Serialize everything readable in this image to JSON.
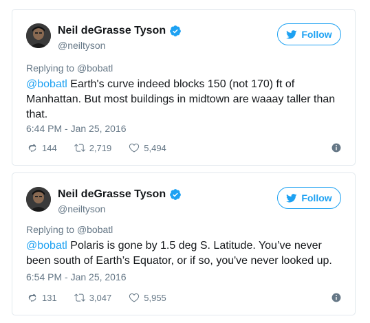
{
  "colors": {
    "link": "#1da1f2",
    "secondary_text": "#657786",
    "primary_text": "#14171a",
    "border": "#e1e8ed"
  },
  "follow_label": "Follow",
  "tweets": [
    {
      "author_name": "Neil deGrasse Tyson",
      "handle": "@neiltyson",
      "replying_prefix": "Replying to ",
      "replying_to": "@bobatl",
      "mention": "@bobatl",
      "body": " Earth's curve indeed blocks 150 (not 170) ft of Manhattan. But most buildings in midtown are waaay taller than that.",
      "timestamp": "6:44 PM - Jan 25, 2016",
      "replies": "144",
      "retweets": "2,719",
      "likes": "5,494"
    },
    {
      "author_name": "Neil deGrasse Tyson",
      "handle": "@neiltyson",
      "replying_prefix": "Replying to ",
      "replying_to": "@bobatl",
      "mention": "@bobatl",
      "body": " Polaris is gone by 1.5 deg S. Latitude. You’ve never been south of Earth’s Equator, or if so, you've never looked up.",
      "timestamp": "6:54 PM - Jan 25, 2016",
      "replies": "131",
      "retweets": "3,047",
      "likes": "5,955"
    }
  ]
}
